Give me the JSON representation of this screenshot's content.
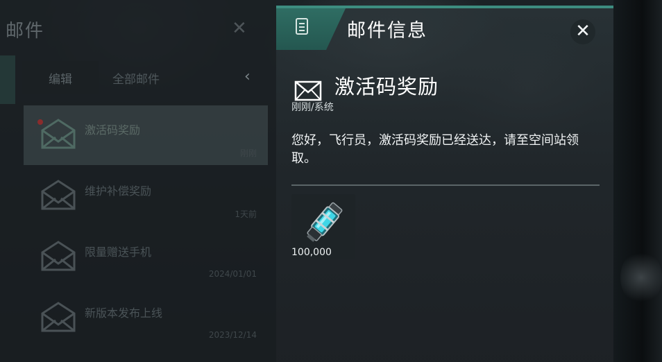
{
  "mailbox": {
    "title": "邮件",
    "edit_label": "编辑",
    "filter_label": "全部邮件",
    "items": [
      {
        "title": "激活码奖励",
        "date": "刚刚"
      },
      {
        "title": "维护补偿奖励",
        "date": "1天前"
      },
      {
        "title": "限量赠送手机",
        "date": "2024/01/01"
      },
      {
        "title": "新版本发布上线",
        "date": "2023/12/14"
      }
    ]
  },
  "detail": {
    "header_title": "邮件信息",
    "subject": "激活码奖励",
    "meta": "刚刚/系统",
    "body": "您好，飞行员，激活码奖励已经送达，请至空间站领取。",
    "attachment": {
      "icon": "energy-capsule-icon",
      "quantity": "100,000"
    }
  },
  "colors": {
    "accent": "#3d8d80",
    "tab": "#2f6d63",
    "capsule_glow": "#3fd6e6"
  }
}
